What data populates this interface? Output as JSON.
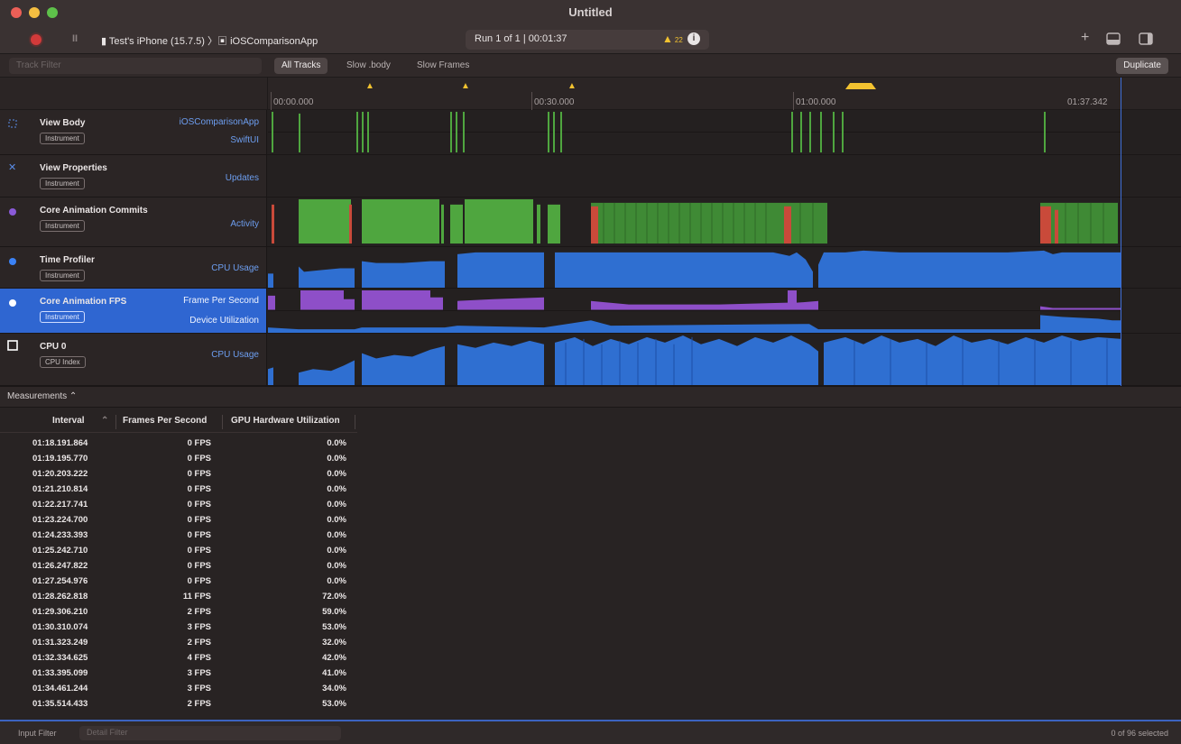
{
  "window": {
    "title": "Untitled"
  },
  "toolbar": {
    "pause_label": "II",
    "device_path": "▮ Test's iPhone (15.7.5) 〉▣ iOSComparisonApp",
    "run_status": "Run 1 of 1  |  00:01:37",
    "warning_glyph": "▲",
    "warning_count": "22",
    "info_glyph": "i",
    "add_glyph": "+"
  },
  "filterbar": {
    "track_filter_placeholder": "Track Filter",
    "scopes": [
      "All Tracks",
      "Slow .body",
      "Slow Frames"
    ],
    "duplicate_label": "Duplicate"
  },
  "ruler": {
    "ticks": [
      "00:00.000",
      "00:30.000",
      "01:00.000",
      "01:37.342"
    ]
  },
  "tracks": [
    {
      "name": "View Body",
      "badge": "Instrument",
      "subs": [
        "iOSComparisonApp",
        "SwiftUI"
      ],
      "icon_color": "#5a8de8"
    },
    {
      "name": "View Properties",
      "badge": "Instrument",
      "subs": [
        "Updates"
      ],
      "icon_color": "#5a8de8"
    },
    {
      "name": "Core Animation Commits",
      "badge": "Instrument",
      "subs": [
        "Activity"
      ],
      "icon_color": "#8a5ad8"
    },
    {
      "name": "Time Profiler",
      "badge": "Instrument",
      "subs": [
        "CPU Usage"
      ],
      "icon_color": "#3b82f6"
    },
    {
      "name": "Core Animation FPS",
      "badge": "Instrument",
      "subs": [
        "Frame Per Second",
        "Device Utilization"
      ],
      "icon_color": "#ffffff"
    },
    {
      "name": "CPU 0",
      "badge": "CPU Index",
      "subs": [
        "CPU Usage"
      ],
      "icon_color": "#ffffff"
    }
  ],
  "colors": {
    "accent": "#2f66d1",
    "green": "#4fa63f",
    "red": "#c94a3a",
    "blue": "#2f6fd1",
    "purple": "#8e4fc8",
    "warning": "#f2c230"
  },
  "detail": {
    "view_label": "Measurements ⌃",
    "columns": [
      "Interval",
      "Frames Per Second",
      "GPU Hardware Utilization"
    ],
    "sort_glyph": "⌃",
    "rows": [
      [
        "01:18.191.864",
        "0 FPS",
        "0.0%"
      ],
      [
        "01:19.195.770",
        "0 FPS",
        "0.0%"
      ],
      [
        "01:20.203.222",
        "0 FPS",
        "0.0%"
      ],
      [
        "01:21.210.814",
        "0 FPS",
        "0.0%"
      ],
      [
        "01:22.217.741",
        "0 FPS",
        "0.0%"
      ],
      [
        "01:23.224.700",
        "0 FPS",
        "0.0%"
      ],
      [
        "01:24.233.393",
        "0 FPS",
        "0.0%"
      ],
      [
        "01:25.242.710",
        "0 FPS",
        "0.0%"
      ],
      [
        "01:26.247.822",
        "0 FPS",
        "0.0%"
      ],
      [
        "01:27.254.976",
        "0 FPS",
        "0.0%"
      ],
      [
        "01:28.262.818",
        "11 FPS",
        "72.0%"
      ],
      [
        "01:29.306.210",
        "2 FPS",
        "59.0%"
      ],
      [
        "01:30.310.074",
        "3 FPS",
        "53.0%"
      ],
      [
        "01:31.323.249",
        "2 FPS",
        "32.0%"
      ],
      [
        "01:32.334.625",
        "4 FPS",
        "42.0%"
      ],
      [
        "01:33.395.099",
        "3 FPS",
        "41.0%"
      ],
      [
        "01:34.461.244",
        "3 FPS",
        "34.0%"
      ],
      [
        "01:35.514.433",
        "2 FPS",
        "53.0%"
      ]
    ]
  },
  "bottombar": {
    "input_filter_label": "Input Filter",
    "detail_filter_placeholder": "Detail Filter",
    "selected_count": "0 of 96 selected"
  }
}
